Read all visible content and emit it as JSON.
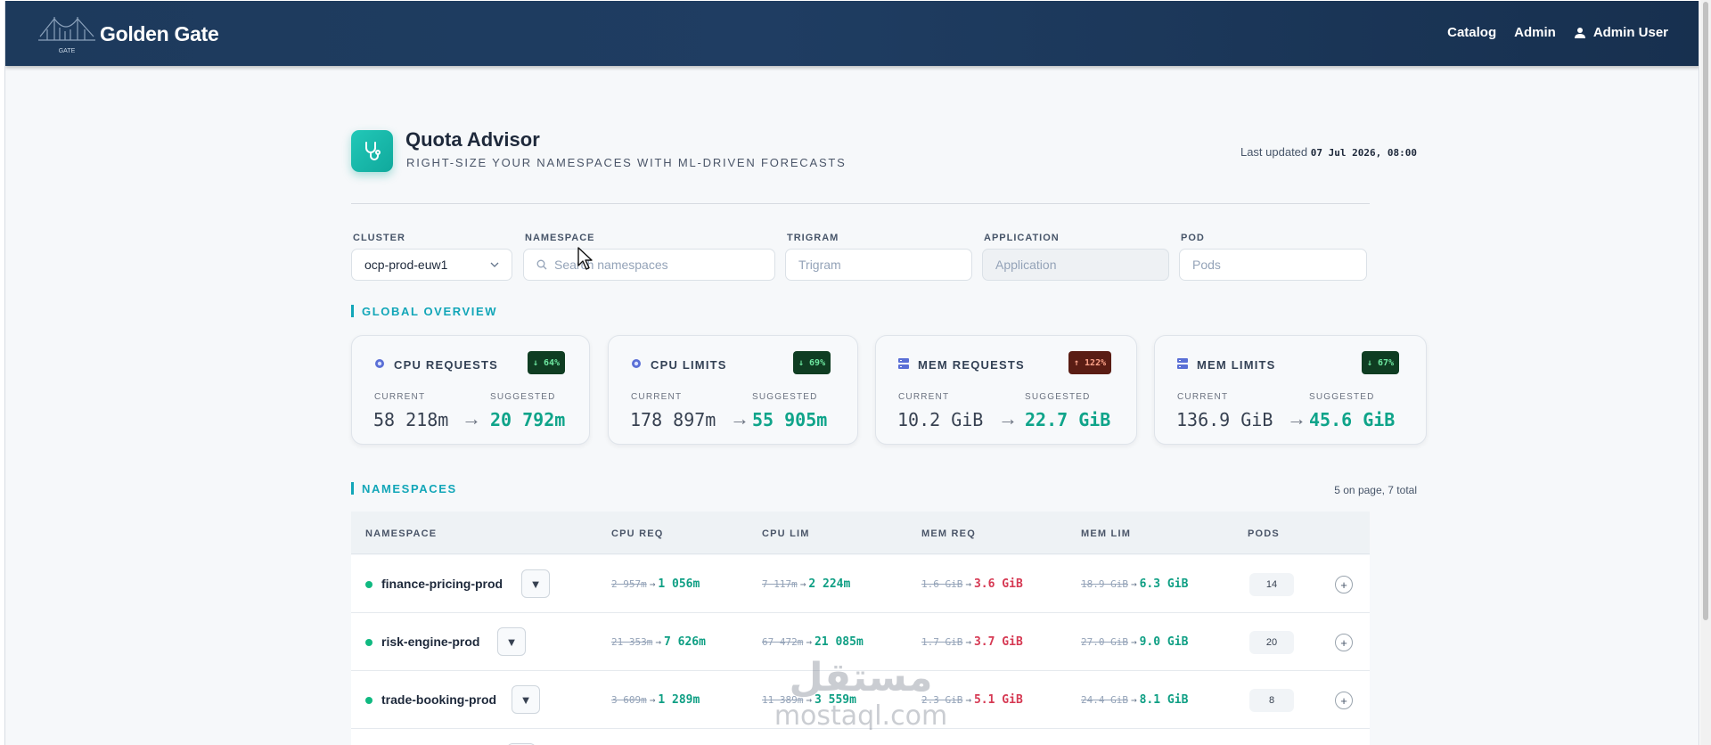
{
  "header": {
    "brand_title": "Golden Gate",
    "brand_logo_text": "GOLDEN GATE",
    "nav": {
      "catalog": "Catalog",
      "admin": "Admin",
      "user": "Admin User"
    }
  },
  "page": {
    "title": "Quota Advisor",
    "subtitle": "RIGHT-SIZE YOUR NAMESPACES WITH ML-DRIVEN FORECASTS",
    "last_updated_label": "Last updated",
    "last_updated_value": "07 Jul 2026, 08:00"
  },
  "filters": {
    "cluster": {
      "label": "CLUSTER",
      "value": "ocp-prod-euw1"
    },
    "namespace": {
      "label": "NAMESPACE",
      "placeholder": "Search namespaces"
    },
    "trigram": {
      "label": "TRIGRAM",
      "placeholder": "Trigram"
    },
    "application": {
      "label": "APPLICATION",
      "placeholder": "Application"
    },
    "pod": {
      "label": "POD",
      "placeholder": "Pods"
    }
  },
  "overview": {
    "section_title": "GLOBAL OVERVIEW",
    "current_label": "CURRENT",
    "suggested_label": "SUGGESTED",
    "cards": [
      {
        "title": "CPU REQUESTS",
        "badge": "↓ 64%",
        "current": "58 218m",
        "suggested": "20 792m",
        "icon": "cpu-icon"
      },
      {
        "title": "CPU LIMITS",
        "badge": "↓ 69%",
        "current": "178 897m",
        "suggested": "55 905m",
        "icon": "cpu-icon"
      },
      {
        "title": "MEM REQUESTS",
        "badge": "↑ 122%",
        "current": "10.2 GiB",
        "suggested": "22.7 GiB",
        "icon": "memory-icon"
      },
      {
        "title": "MEM LIMITS",
        "badge": "↓ 67%",
        "current": "136.9 GiB",
        "suggested": "45.6 GiB",
        "icon": "memory-icon"
      }
    ],
    "colors": {
      "accent": "#12a6b8",
      "good": "#0fa48a",
      "bad": "#d63953"
    }
  },
  "namespaces": {
    "section_title": "NAMESPACES",
    "count_text": "5 on page, 7 total",
    "columns": [
      "NAMESPACE",
      "CPU REQ",
      "CPU LIM",
      "MEM REQ",
      "MEM LIM",
      "PODS"
    ],
    "rows": [
      {
        "name": "finance-pricing-prod",
        "cpu_req_old": "2 957m",
        "cpu_req_new": "1 056m",
        "cpu_lim_old": "7 117m",
        "cpu_lim_new": "2 224m",
        "mem_req_old": "1.6 GiB",
        "mem_req_new": "3.6 GiB",
        "mem_lim_old": "18.9 GiB",
        "mem_lim_new": "6.3 GiB",
        "pods": "14"
      },
      {
        "name": "risk-engine-prod",
        "cpu_req_old": "21 353m",
        "cpu_req_new": "7 626m",
        "cpu_lim_old": "67 472m",
        "cpu_lim_new": "21 085m",
        "mem_req_old": "1.7 GiB",
        "mem_req_new": "3.7 GiB",
        "mem_lim_old": "27.0 GiB",
        "mem_lim_new": "9.0 GiB",
        "pods": "20"
      },
      {
        "name": "trade-booking-prod",
        "cpu_req_old": "3 609m",
        "cpu_req_new": "1 289m",
        "cpu_lim_old": "11 389m",
        "cpu_lim_new": "3 559m",
        "mem_req_old": "2.3 GiB",
        "mem_req_new": "5.1 GiB",
        "mem_lim_old": "24.4 GiB",
        "mem_lim_new": "8.1 GiB",
        "pods": "8"
      }
    ]
  },
  "watermark": {
    "arabic": "مستقل",
    "latin": "mostaql.com"
  }
}
